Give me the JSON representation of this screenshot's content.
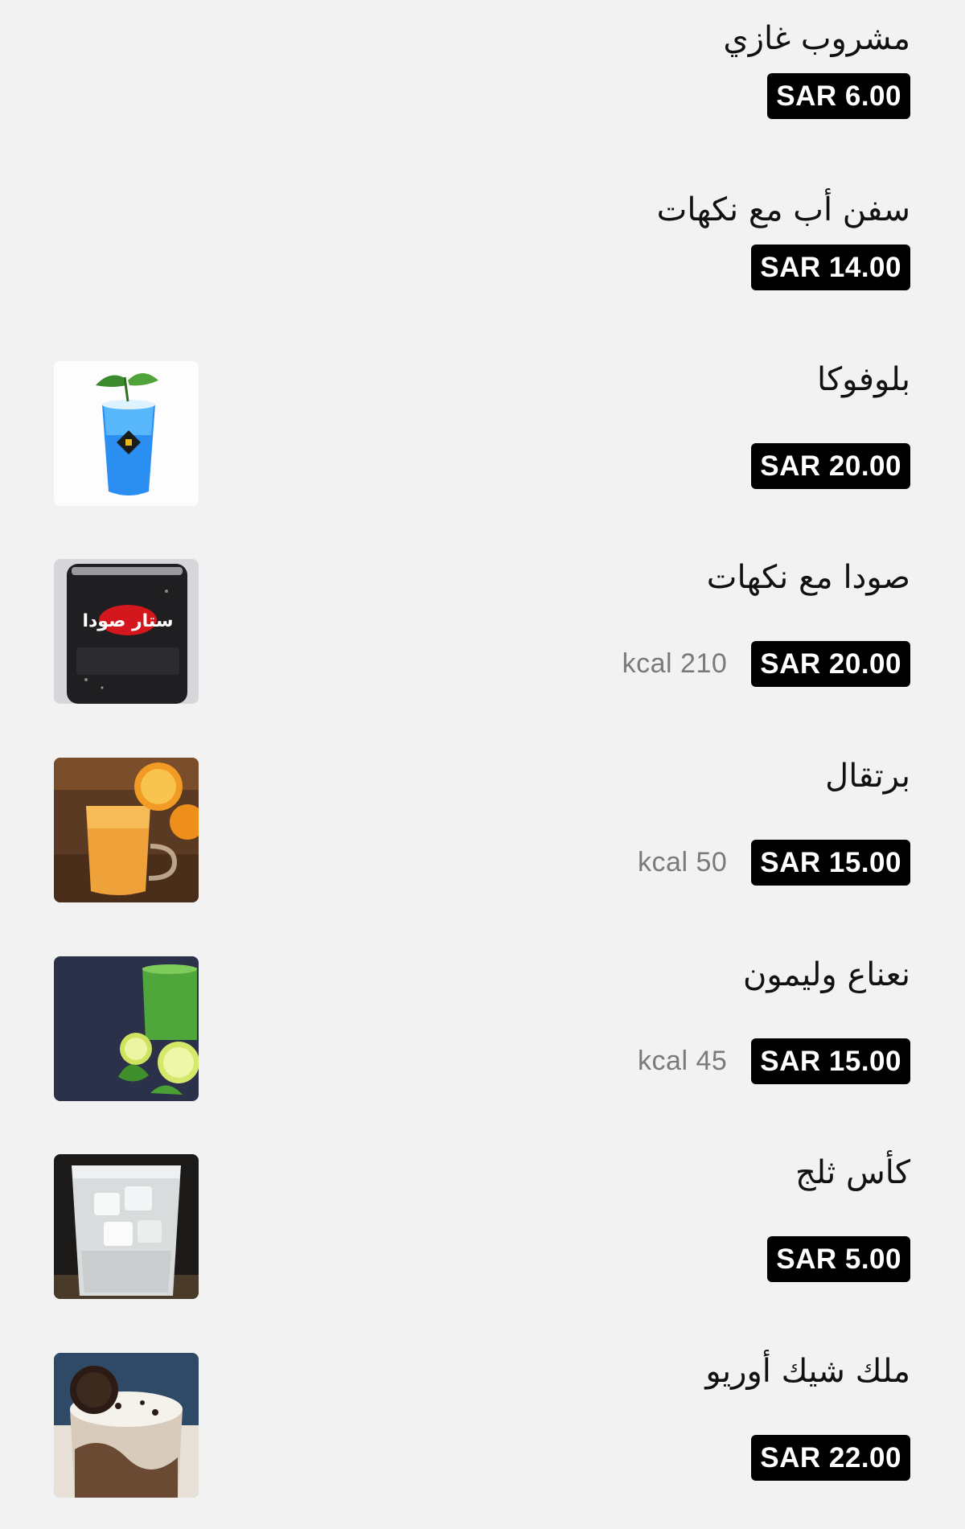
{
  "menu": {
    "items": [
      {
        "name": "مشروب غازي",
        "price": "SAR 6.00",
        "kcal": null,
        "image": null
      },
      {
        "name": "سفن أب مع نكهات",
        "price": "SAR 14.00",
        "kcal": null,
        "image": null
      },
      {
        "name": "بلوفوكا",
        "price": "SAR 20.00",
        "kcal": null,
        "image": "blue-mojito-cup-photo"
      },
      {
        "name": "صودا مع نكهات",
        "price": "SAR 20.00",
        "kcal": "kcal 210",
        "image": "star-soda-can-photo",
        "image_text": "ستار صودا"
      },
      {
        "name": "برتقال",
        "price": "SAR 15.00",
        "kcal": "kcal 50",
        "image": "orange-juice-glass-photo"
      },
      {
        "name": "نعناع وليمون",
        "price": "SAR 15.00",
        "kcal": "kcal 45",
        "image": "mint-lemon-juice-photo"
      },
      {
        "name": "كأس ثلج",
        "price": "SAR 5.00",
        "kcal": null,
        "image": "ice-glass-photo"
      },
      {
        "name": "ملك شيك أوريو",
        "price": "SAR 22.00",
        "kcal": null,
        "image": "oreo-milkshake-photo"
      }
    ]
  },
  "colors": {
    "background": "#f2f2f3",
    "price_badge_bg": "#000000",
    "price_badge_text": "#ffffff",
    "kcal_text": "#7a7a7a"
  }
}
